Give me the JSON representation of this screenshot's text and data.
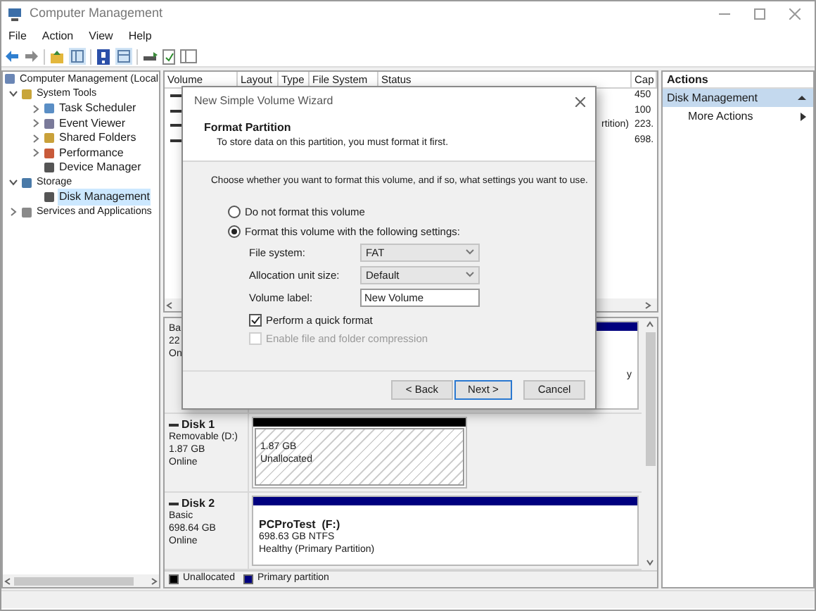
{
  "window": {
    "title": "Computer Management"
  },
  "menu": [
    "File",
    "Action",
    "View",
    "Help"
  ],
  "tree": [
    {
      "label": "Computer Management (Local",
      "expandable": false,
      "selected": false,
      "children": [
        {
          "label": "System Tools",
          "expandable": true,
          "expanded": true,
          "selected": false,
          "children": [
            {
              "label": "Task Scheduler",
              "expandable": true,
              "expanded": false,
              "selected": false
            },
            {
              "label": "Event Viewer",
              "expandable": true,
              "expanded": false,
              "selected": false
            },
            {
              "label": "Shared Folders",
              "expandable": true,
              "expanded": false,
              "selected": false
            },
            {
              "label": "Performance",
              "expandable": true,
              "expanded": false,
              "selected": false
            },
            {
              "label": "Device Manager",
              "expandable": false,
              "selected": false
            }
          ]
        },
        {
          "label": "Storage",
          "expandable": true,
          "expanded": true,
          "selected": false,
          "children": [
            {
              "label": "Disk Management",
              "expandable": false,
              "selected": true
            }
          ]
        },
        {
          "label": "Services and Applications",
          "expandable": true,
          "expanded": false,
          "selected": false
        }
      ]
    }
  ],
  "volume_table": {
    "columns": [
      "Volume",
      "Layout",
      "Type",
      "File System",
      "Status",
      "Cap"
    ],
    "rows": [
      {
        "capacity": "450"
      },
      {
        "capacity": "100"
      },
      {
        "status": "rtition)",
        "capacity": "223."
      },
      {
        "capacity": "698."
      }
    ]
  },
  "disks": [
    {
      "lines": [
        "Ba",
        "22",
        "On"
      ],
      "partitions": [
        {
          "kind": "primary",
          "lines": [
            "y"
          ]
        }
      ]
    },
    {
      "name": "Disk 1",
      "lines": [
        "Removable (D:)",
        "1.87 GB",
        "Online"
      ],
      "partitions": [
        {
          "kind": "unallocated",
          "lines": [
            "1.87 GB",
            "Unallocated"
          ]
        }
      ]
    },
    {
      "name": "Disk 2",
      "lines": [
        "Basic",
        "698.64 GB",
        "Online"
      ],
      "partitions": [
        {
          "kind": "primary",
          "name": "PCProTest  (F:)",
          "lines": [
            "698.63 GB NTFS",
            "Healthy (Primary Partition)"
          ]
        }
      ]
    }
  ],
  "legend": [
    {
      "label": "Unallocated",
      "color": "#000000"
    },
    {
      "label": "Primary partition",
      "color": "#00007f"
    }
  ],
  "actions": {
    "title": "Actions",
    "items": [
      {
        "label": "Disk Management",
        "kind": "section"
      },
      {
        "label": "More Actions",
        "kind": "submenu"
      }
    ]
  },
  "dialog": {
    "title": "New Simple Volume Wizard",
    "heading": "Format Partition",
    "subheading": "To store data on this partition, you must format it first.",
    "prompt": "Choose whether you want to format this volume, and if so, what settings you want to use.",
    "options": [
      {
        "label": "Do not format this volume",
        "selected": false
      },
      {
        "label": "Format this volume with the following settings:",
        "selected": true
      }
    ],
    "settings": [
      {
        "label": "File system:",
        "kind": "dropdown",
        "value": "FAT"
      },
      {
        "label": "Allocation unit size:",
        "kind": "dropdown",
        "value": "Default"
      },
      {
        "label": "Volume label:",
        "kind": "text",
        "value": "New Volume"
      }
    ],
    "checks": [
      {
        "label": "Perform a quick format",
        "checked": true,
        "disabled": false
      },
      {
        "label": "Enable file and folder compression",
        "checked": false,
        "disabled": true
      }
    ],
    "buttons": [
      {
        "label": "< Back",
        "default": false
      },
      {
        "label": "Next >",
        "default": true
      },
      {
        "label": "Cancel",
        "default": false
      }
    ]
  }
}
